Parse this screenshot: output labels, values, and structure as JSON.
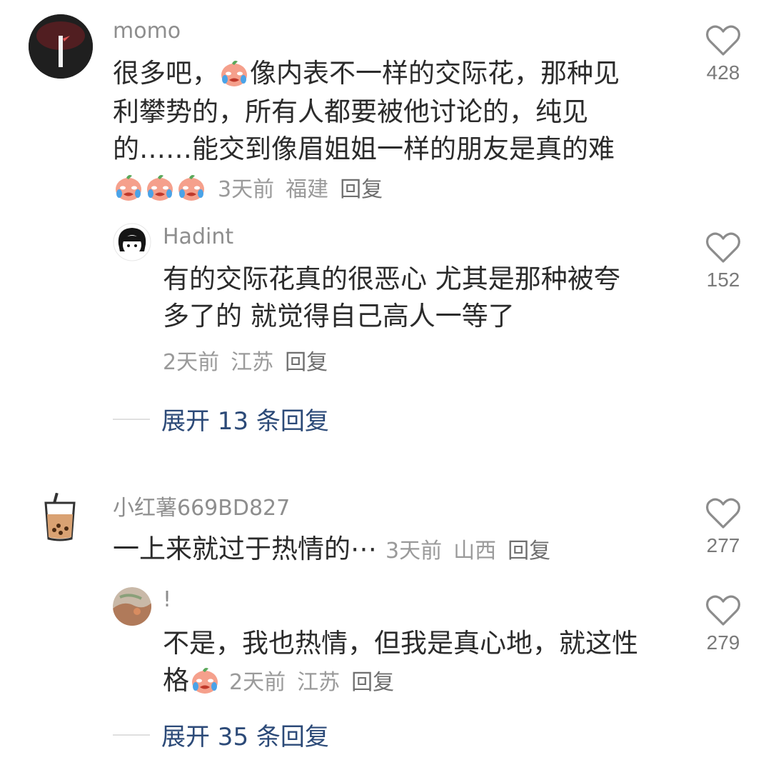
{
  "comments": [
    {
      "username": "momo",
      "text_lines": [
        "很多吧，",
        "像内表不一样的交际花，那种见",
        "利攀势的，所有人都要被他讨论的，纯见",
        "的……能交到像眉姐姐一样的朋友是真的难"
      ],
      "time": "3天前",
      "location": "福建",
      "reply_label": "回复",
      "likes": "428",
      "reply": {
        "username": "Hadint",
        "text_lines": [
          "有的交际花真的很恶心 尤其是那种被夸",
          "多了的 就觉得自己高人一等了"
        ],
        "time": "2天前",
        "location": "江苏",
        "reply_label": "回复",
        "likes": "152"
      },
      "expand_label": "展开 13 条回复"
    },
    {
      "username": "小红薯669BD827",
      "text": "一上来就过于热情的⋯",
      "time": "3天前",
      "location": "山西",
      "reply_label": "回复",
      "likes": "277",
      "reply": {
        "username": "!",
        "text_lines": [
          "不是，我也热情，但我是真心地，就这性",
          "格"
        ],
        "time": "2天前",
        "location": "江苏",
        "reply_label": "回复",
        "likes": "279"
      },
      "expand_label": "展开 35 条回复"
    }
  ],
  "icons": {
    "like": "heart-outline-icon",
    "emoji": "crying-peach-emoji"
  },
  "colors": {
    "expand_link": "#2c4a78",
    "username": "#8e8e8e"
  }
}
